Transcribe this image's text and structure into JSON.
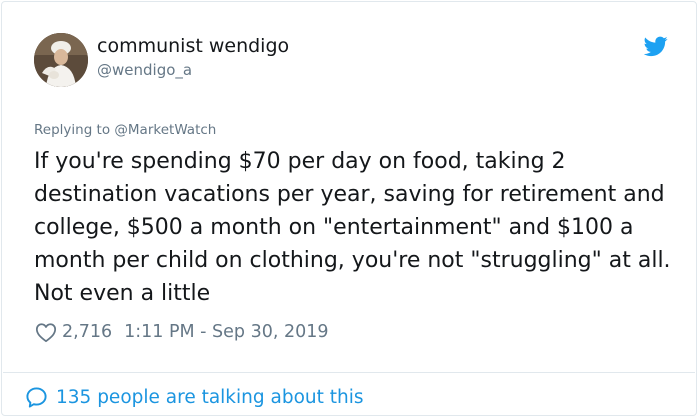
{
  "author": {
    "display_name": "communist wendigo",
    "handle": "@wendigo_a",
    "avatar_icon": "avatar-photo"
  },
  "brand": {
    "icon": "twitter-bird-icon",
    "color": "#1da1f2"
  },
  "reply": {
    "prefix": "Replying to",
    "mention": "@MarketWatch"
  },
  "tweet": {
    "text": "If you're spending $70 per day on food, taking 2 destination vacations per year, saving for retirement and college, $500 a month on \"entertainment\" and $100 a month per child on clothing, you're not \"struggling\" at all. Not even a little"
  },
  "meta": {
    "likes": "2,716",
    "timestamp": "1:11 PM - Sep 30, 2019",
    "heart_icon": "heart-icon"
  },
  "footer": {
    "talking": "135 people are talking about this",
    "bubble_icon": "speech-bubble-icon",
    "link_color": "#1b95e0"
  }
}
